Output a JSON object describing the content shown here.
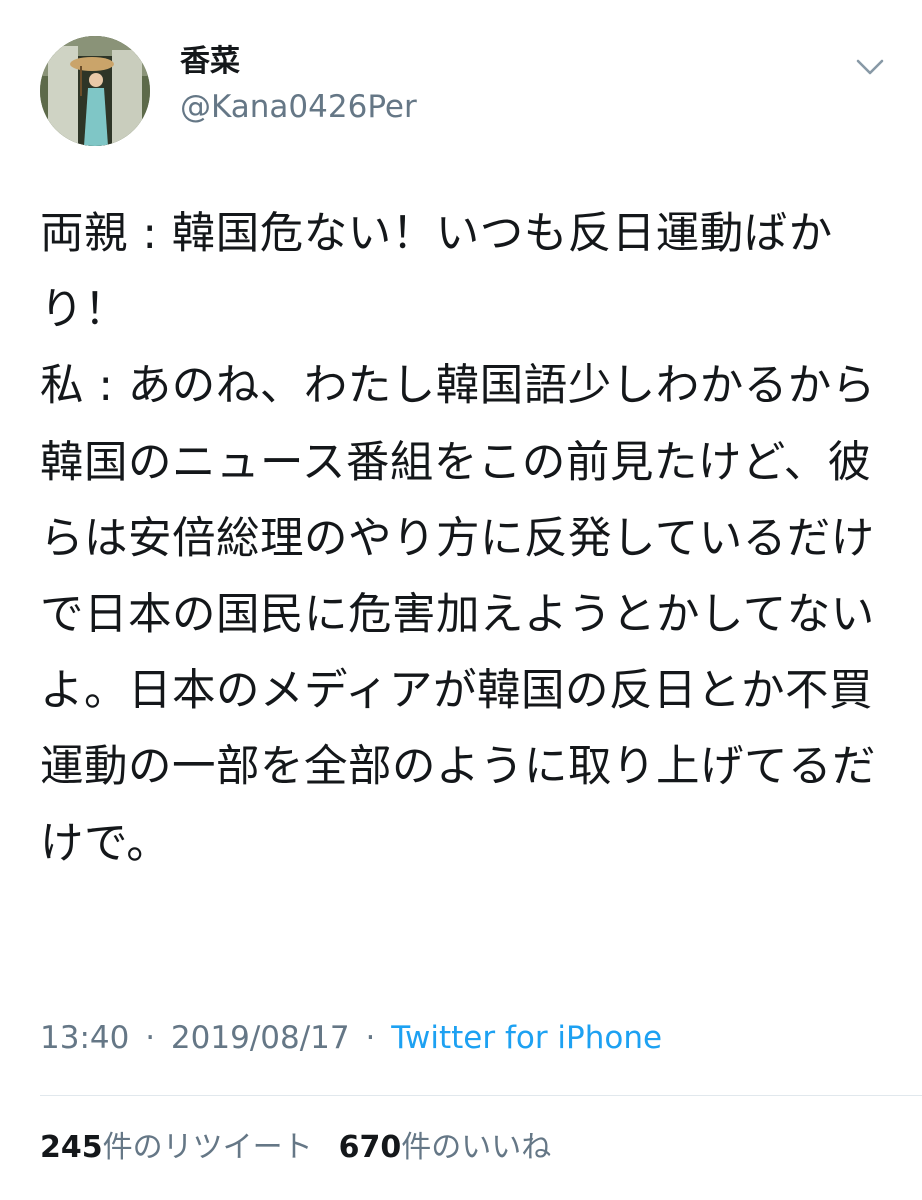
{
  "author": {
    "display_name": "香菜",
    "username": "@Kana0426Per"
  },
  "tweet": {
    "text": "両親 : 韓国危ない！いつも反日運動ばかり！\n私 : あのね、わたし韓国語少しわかるから韓国のニュース番組をこの前見たけど、彼らは安倍総理のやり方に反発しているだけで日本の国民に危害加えようとかしてないよ。日本のメディアが韓国の反日とか不買運動の一部を全部のように取り上げてるだけで。"
  },
  "meta": {
    "time": "13:40",
    "separator": "·",
    "date": "2019/08/17",
    "source": "Twitter for iPhone"
  },
  "stats": {
    "retweets_count": "245",
    "retweets_label": "件のリツイート",
    "likes_count": "670",
    "likes_label": "件のいいね"
  },
  "icons": {
    "avatar": "profile-photo",
    "caret": "chevron-down-icon"
  },
  "colors": {
    "text": "#14171a",
    "secondary": "#657786",
    "link": "#1da1f2",
    "divider": "#e1e8ed"
  }
}
